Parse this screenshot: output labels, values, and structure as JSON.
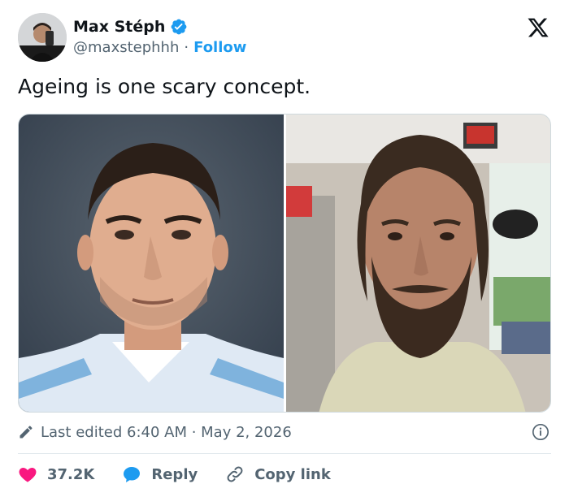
{
  "author": {
    "display_name": "Max Stéph",
    "handle": "@maxstephhh",
    "separator": "·",
    "follow_label": "Follow"
  },
  "tweet": {
    "text": "Ageing is one scary concept."
  },
  "media": {
    "left_image": "young clean-shaven man in light-blue striped football shirt",
    "right_image": "older bearded man with receding hairline in a shop with EXIT sign"
  },
  "meta": {
    "edited_label": "Last edited 6:40 AM · May 2, 2026"
  },
  "actions": {
    "like_count": "37.2K",
    "reply_label": "Reply",
    "copy_link_label": "Copy link"
  },
  "colors": {
    "accent": "#1d9bf0",
    "like": "#f91880",
    "secondary_text": "#536471",
    "primary_text": "#0f1419"
  },
  "icons": [
    "verified-badge-icon",
    "x-logo-icon",
    "pencil-icon",
    "info-icon",
    "heart-icon",
    "reply-bubble-icon",
    "link-icon"
  ]
}
